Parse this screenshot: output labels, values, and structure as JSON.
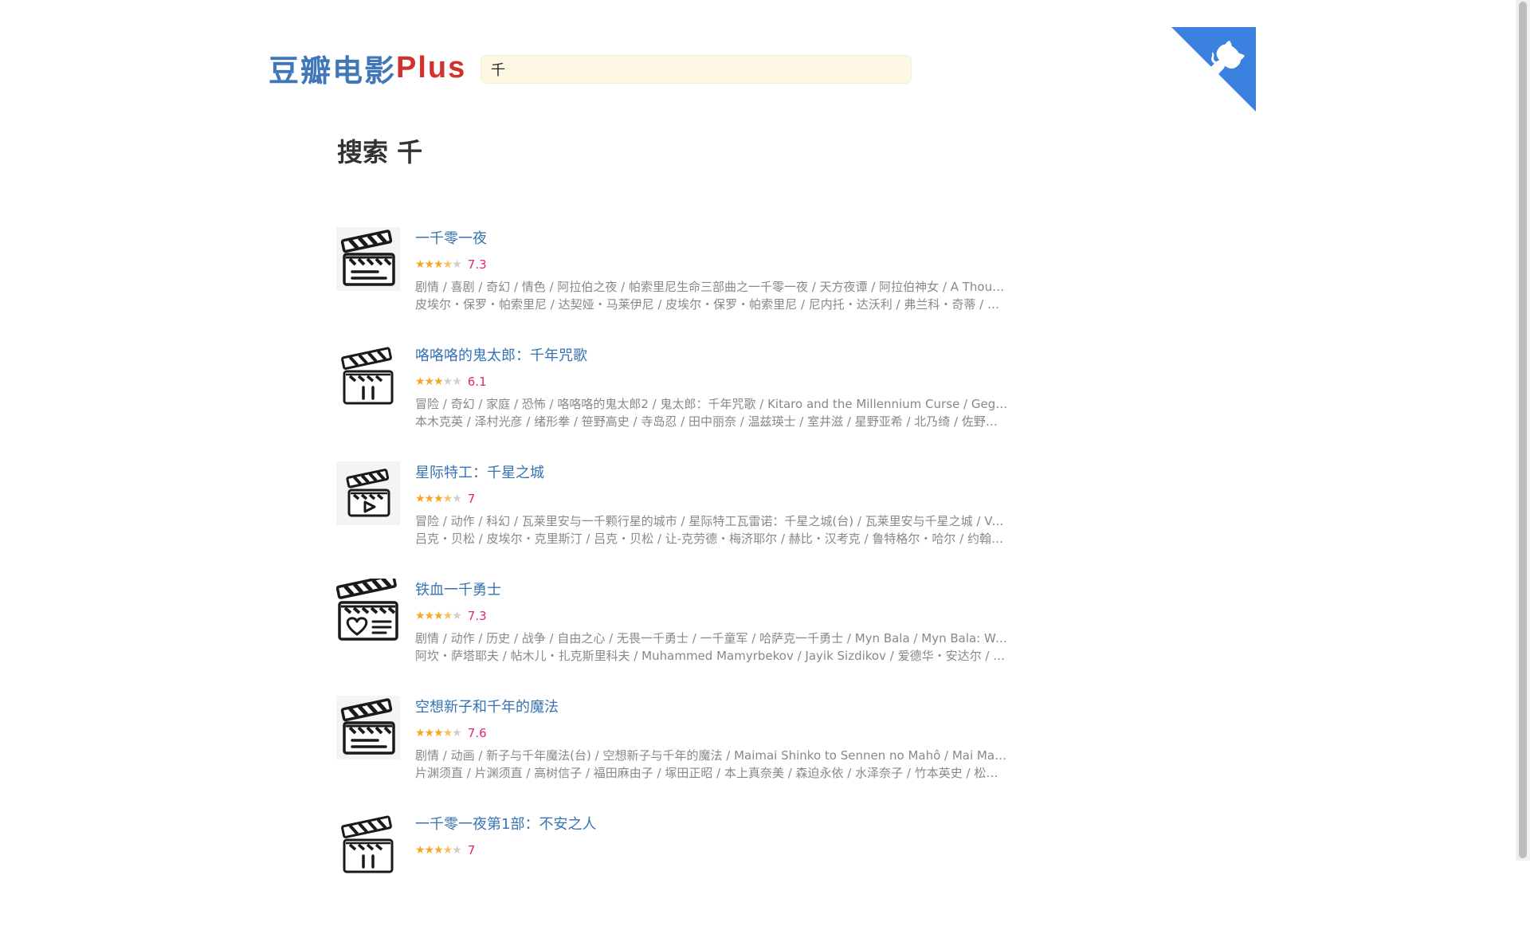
{
  "app": {
    "logo_cn": "豆瓣电影",
    "logo_plus": "Plus",
    "brand_blue": "#3f77b9",
    "brand_red": "#d2322e"
  },
  "search": {
    "value": "千"
  },
  "page": {
    "title": "搜索 千"
  },
  "results": [
    {
      "title": "一千零一夜",
      "rating": 7.3,
      "stars": 3.5,
      "score": "7.3",
      "poster_icon": "clapperboard-doc-icon",
      "tags": "剧情 / 喜剧 / 奇幻 / 情色 / 阿拉伯之夜 / 帕索里尼生命三部曲之一千零一夜 / 天方夜谭 / 阿拉伯神女 / A Thousand and One Nights",
      "cast": "皮埃尔・保罗・帕索里尼 / 达契娅・马莱伊尼 / 皮埃尔・保罗・帕索里尼 / 尼内托・达沃利 / 弗兰科・奇蒂 / 弗兰科"
    },
    {
      "title": "咯咯咯的鬼太郎：千年咒歌",
      "rating": 6.1,
      "stars": 3,
      "score": "6.1",
      "poster_icon": "clapperboard-pause-icon",
      "tags": "冒险 / 奇幻 / 家庭 / 恐怖 / 咯咯咯的鬼太郎2 / 鬼太郎：千年咒歌 / Kitaro and the Millennium Curse / Gegege no Kitaro",
      "cast": "本木克英 / 泽村光彦 / 绪形拳 / 笹野高史 / 寺岛忍 / 田中丽奈 / 温兹瑛士 / 室井滋 / 星野亚希 / 北乃绮 / 佐野史郎 / 西田敏行"
    },
    {
      "title": "星际特工：千星之城",
      "rating": 7,
      "stars": 3.5,
      "score": "7",
      "poster_icon": "clapperboard-play-icon",
      "tags": "冒险 / 动作 / 科幻 / 瓦莱里安与一千颗行星的城市 / 星际特工瓦雷诺：千星之城(台) / 瓦莱里安与千星之城 / Valerian and the City",
      "cast": "吕克・贝松 / 皮埃尔・克里斯汀 / 吕克・贝松 / 让-克劳德・梅济耶尔 / 赫比・汉考克 / 鲁特格尔・哈尔 / 约翰・古德曼"
    },
    {
      "title": "铁血一千勇士",
      "rating": 7.3,
      "stars": 3.5,
      "score": "7.3",
      "poster_icon": "clapperboard-heart-icon",
      "tags": "剧情 / 动作 / 历史 / 战争 / 自由之心 / 无畏一千勇士 / 一千童军 / 哈萨克一千勇士 / Myn Bala / Myn Bala: Warriors of the Steppe",
      "cast": "阿坎・萨塔耶夫 / 帖木儿・扎克斯里科夫 / Muhammed Mamyrbekov / Jayik Sizdikov / 爱德华・安达尔 / 多斯汗"
    },
    {
      "title": "空想新子和千年的魔法",
      "rating": 7.6,
      "stars": 3.5,
      "score": "7.6",
      "poster_icon": "clapperboard-doc-icon",
      "tags": "剧情 / 动画 / 新子与千年魔法(台) / 空想新子与千年的魔法 / Maimai Shinko to Sennen no Mahô / Mai Mai Miracle",
      "cast": "片渊须直 / 片渊须直 / 高树信子 / 福田麻由子 / 塚田正昭 / 本上真奈美 / 森迫永依 / 水泽奈子 / 竹本英史 / 松元环季 / 中嶋和也"
    },
    {
      "title": "一千零一夜第1部：不安之人",
      "rating": 7,
      "stars": 3.5,
      "score": "7",
      "poster_icon": "clapperboard-pause-icon",
      "tags": "",
      "cast": ""
    }
  ]
}
